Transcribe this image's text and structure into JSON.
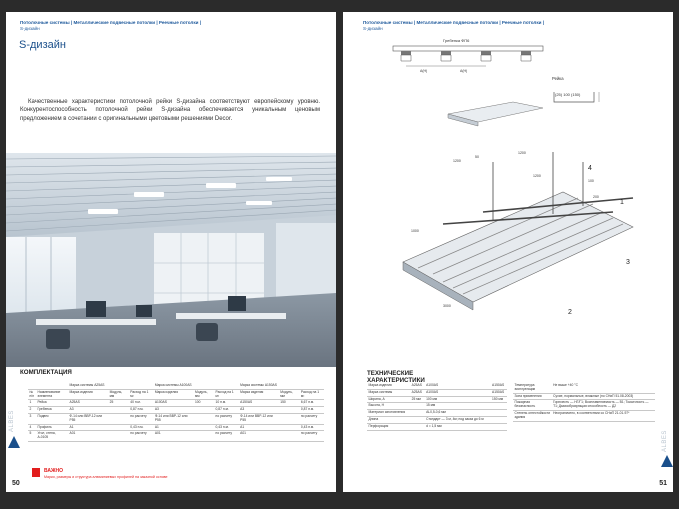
{
  "left_page": {
    "breadcrumb_main": "Потолочные системы | Металлические подвесные потолки | Реечные потолки |",
    "breadcrumb_sub": "S-дизайн",
    "title": "S-дизайн",
    "description": "Качественные характеристики потолочной рейки S-дизайна соответствуют европейскому уровню. Конкурентоспособность потолочной рейки S-дизайна обеспечивается уникальным ценовым предложением в сочетании с оригинальными цветовыми решениями Decor.",
    "section_title": "КОМПЛЕКТАЦИЯ",
    "page_number": "50",
    "important_label": "ВАЖНО",
    "important_text": "Марки, размеры и структура алюминиевых профилей на заказной основе",
    "side_logo": "ALBES",
    "table": {
      "group_headers": [
        "Марка системы А25АS",
        "Марка системы А100АS",
        "Марка системы А150АS"
      ],
      "col_headers": [
        "№ п/п",
        "Наименование элемента",
        "Марка изделия",
        "Модуль, мм",
        "Расход на 1 м²",
        "Марка изделия",
        "Модуль, мм",
        "Расход на 1 м²",
        "Марка изделия",
        "Модуль, мм",
        "Расход на 1 м²"
      ],
      "rows": [
        [
          "1",
          "Рейка",
          "А25АS",
          "25",
          "40 п.м.",
          "А100АS",
          "100",
          "10 п.м.",
          "А150АS",
          "150",
          "6,67 п.м."
        ],
        [
          "2",
          "Гребенка",
          "А3",
          "",
          "0,87 п.м.",
          "А3",
          "",
          "0,87 п.м.",
          "А3",
          "",
          "0,87 п.м."
        ],
        [
          "3",
          "Подвес",
          "Ф-14 или ВВР-12 или Р55",
          "",
          "по расчету",
          "Ф-14 или ВВР-12 или Р55",
          "",
          "по расчету",
          "Ф-14 или ВВР-12 или Р55",
          "",
          "по расчету"
        ],
        [
          "4",
          "Профиль",
          "А1",
          "",
          "0,43 п.м.",
          "А1",
          "",
          "0,43 п.м.",
          "А1",
          "",
          "0,43 п.м."
        ],
        [
          "5",
          "Угол, стена, А-0105",
          "А01",
          "",
          "по расчету",
          "А01",
          "",
          "по расчету",
          "А01",
          "",
          "по расчету"
        ]
      ]
    }
  },
  "right_page": {
    "breadcrumb_main": "Потолочные системы | Металлические подвесные потолки | Реечные потолки |",
    "breadcrumb_sub": "S-дизайн",
    "section_title": "ТЕХНИЧЕСКИЕ ХАРАКТЕРИСТИКИ",
    "page_number": "51",
    "side_logo": "ALBES",
    "drawing_labels": {
      "comb": "Гребенка ФП6",
      "rail": "Рейка",
      "dims_a": "А(Н)",
      "dims_b": "А(Н)",
      "rail_sizes": "(25) 100 (150)",
      "dim_1200_a": "1200",
      "dim_1200_b": "1200",
      "dim_1200_c": "1200",
      "dim_1000": "1000",
      "dim_100": "100",
      "dim_50": "50",
      "dim_200": "200",
      "dim_3000": "3000",
      "callouts": [
        "1",
        "2",
        "3",
        "4"
      ]
    },
    "tech_left": {
      "rows": [
        [
          "Марка изделия",
          "А25АS",
          "А100АS",
          "А150АS"
        ],
        [
          "Марка системы",
          "А25АS",
          "А100АS",
          "А150АS"
        ],
        [
          "Ширина, А",
          "25 мм",
          "100 мм",
          "150 мм"
        ],
        [
          "Высота, H",
          "",
          "15 мм",
          ""
        ],
        [
          "Материал изготовления",
          "",
          "AL0,5-0,6 мм",
          ""
        ],
        [
          "Длина",
          "",
          "Стандарт — 3 м, 4м; под заказ до 6 м",
          ""
        ],
        [
          "Перфорация",
          "",
          "d = 1,5 мм",
          ""
        ]
      ]
    },
    "tech_right": {
      "rows": [
        [
          "Температура эксплуатации",
          "Не выше +40 °С"
        ],
        [
          "Зона применения",
          "Сухие, нормальные, влажные (по СНиП 51.08-2003)"
        ],
        [
          "Пожарная безопасность",
          "Горючесть — НГ/Г1; Воспламеняемость — В1; Токсичность — Т1; Дымообразующая способность — Д2"
        ],
        [
          "Степень огнестойкости здания",
          "Неограничено, в соответствии со СНиП 21-01-97*"
        ]
      ]
    }
  },
  "colors": {
    "brand_blue": "#1a4f8b",
    "important_red": "#e21d1d",
    "background": "#2b2b2b"
  }
}
